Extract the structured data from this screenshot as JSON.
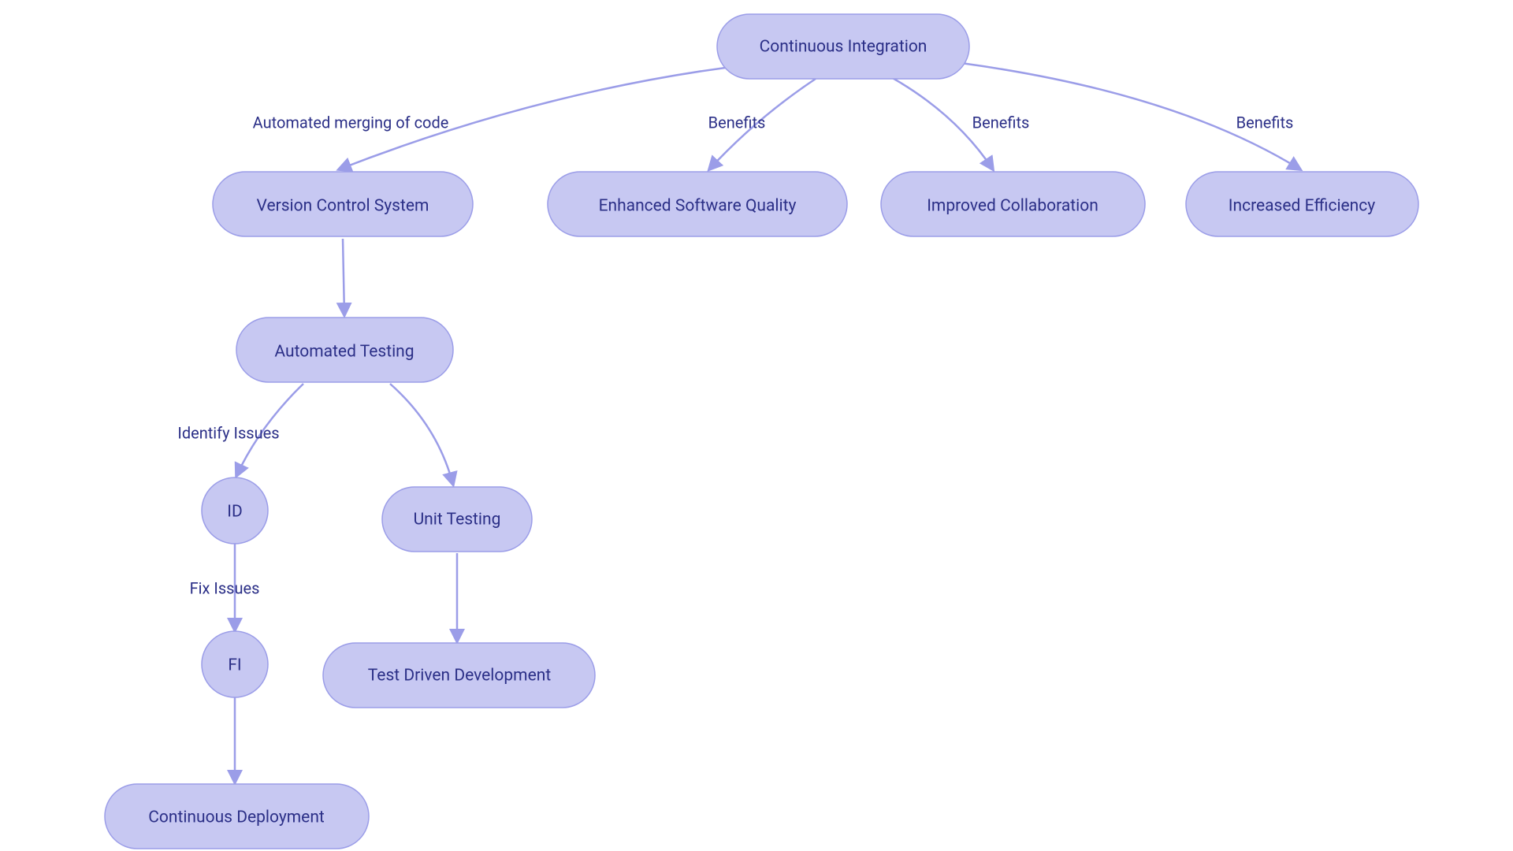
{
  "nodes": {
    "ci": "Continuous Integration",
    "vcs": "Version Control System",
    "esq": "Enhanced Software Quality",
    "ic": "Improved Collaboration",
    "ie": "Increased Efficiency",
    "at": "Automated Testing",
    "id": "ID",
    "ut": "Unit Testing",
    "fi": "FI",
    "tdd": "Test Driven Development",
    "cd": "Continuous Deployment"
  },
  "edges": {
    "ci_vcs": "Automated merging of code",
    "ci_esq": "Benefits",
    "ci_ic": "Benefits",
    "ci_ie": "Benefits",
    "at_id": "Identify Issues",
    "id_fi": "Fix Issues"
  }
}
